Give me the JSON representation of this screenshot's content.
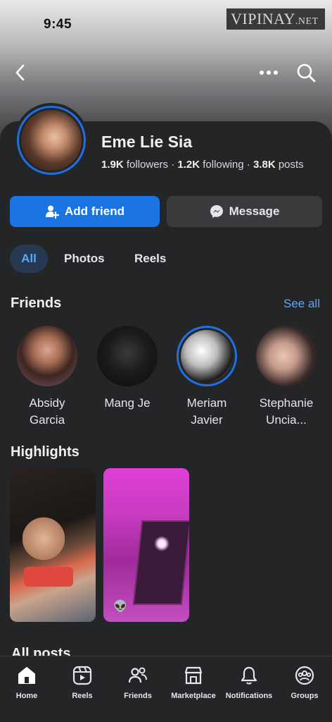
{
  "status_bar": {
    "time": "9:45"
  },
  "watermark": {
    "text": "VIPINAY",
    "suffix": ".NET"
  },
  "profile": {
    "name": "Eme Lie Sia",
    "followers_count": "1.9K",
    "followers_label": "followers",
    "following_count": "1.2K",
    "following_label": "following",
    "posts_count": "3.8K",
    "posts_label": "posts",
    "separator": "·"
  },
  "actions": {
    "add_friend_label": "Add friend",
    "message_label": "Message"
  },
  "filters": {
    "tabs": [
      {
        "label": "All",
        "active": true
      },
      {
        "label": "Photos",
        "active": false
      },
      {
        "label": "Reels",
        "active": false
      }
    ]
  },
  "friends": {
    "title": "Friends",
    "see_all_label": "See all",
    "items": [
      {
        "name": "Absidy Garcia"
      },
      {
        "name": "Mang Je"
      },
      {
        "name": "Meriam Javier"
      },
      {
        "name": "Stephanie Uncia..."
      }
    ]
  },
  "highlights": {
    "title": "Highlights",
    "items": [
      {
        "emoji": ""
      },
      {
        "emoji": "👽"
      }
    ]
  },
  "all_posts": {
    "title": "All posts"
  },
  "bottom_nav": {
    "items": [
      {
        "label": "Home",
        "icon": "home-icon"
      },
      {
        "label": "Reels",
        "icon": "reels-icon"
      },
      {
        "label": "Friends",
        "icon": "friends-icon"
      },
      {
        "label": "Marketplace",
        "icon": "marketplace-icon"
      },
      {
        "label": "Notifications",
        "icon": "bell-icon"
      },
      {
        "label": "Groups",
        "icon": "groups-icon"
      }
    ]
  },
  "colors": {
    "accent": "#1b74e4",
    "link": "#5aa7ff",
    "background": "#242527",
    "secondary_button": "#3a3b3c"
  }
}
